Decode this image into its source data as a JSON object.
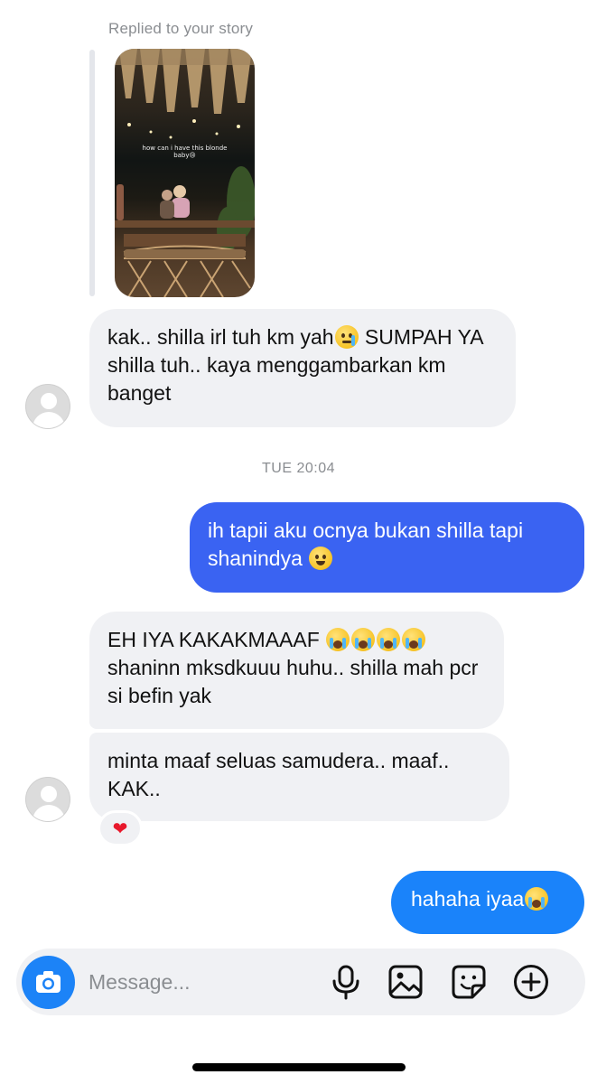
{
  "story_reply": {
    "label": "Replied to your story",
    "thumbnail_caption": "how can i have this blonde baby😢"
  },
  "messages": {
    "msg1": {
      "text_a": "kak.. shilla irl tuh km yah",
      "emoji_a": "crying-face",
      "text_b": " SUMPAH YA shilla tuh.. kaya menggambarkan km banget"
    },
    "timestamp": "TUE 20:04",
    "msg2": {
      "text": "ih tapii aku ocnya bukan shilla tapi shanindya ",
      "emoji": "melting-face"
    },
    "msg3": {
      "text_a": "EH IYA KAKAKMAAAF ",
      "emojis": [
        "loudly-crying-face",
        "loudly-crying-face",
        "loudly-crying-face",
        "loudly-crying-face"
      ],
      "text_b": " shaninn mksdkuuu huhu.. shilla mah pcr si befin yak"
    },
    "msg4": {
      "text": "minta maaf seluas samudera.. maaf.. KAK..",
      "reaction": "❤"
    },
    "msg5": {
      "text": "hahaha iyaa",
      "emoji": "loudly-crying-face"
    }
  },
  "composer": {
    "placeholder": "Message...",
    "icons": [
      "camera-icon",
      "microphone-icon",
      "image-icon",
      "sticker-icon",
      "plus-icon"
    ]
  },
  "colors": {
    "outgoing_purple": "#3a63f2",
    "outgoing_blue": "#1a83fa",
    "incoming_bg": "#f0f1f4",
    "accent": "#1c83f7"
  }
}
